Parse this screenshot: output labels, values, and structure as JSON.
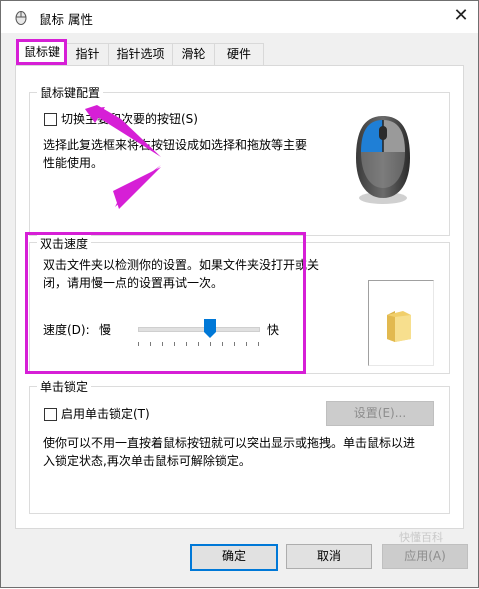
{
  "window": {
    "title": "鼠标 属性",
    "close_label": "✕"
  },
  "tabs": [
    {
      "label": "鼠标键",
      "active": true
    },
    {
      "label": "指针",
      "active": false
    },
    {
      "label": "指针选项",
      "active": false
    },
    {
      "label": "滑轮",
      "active": false
    },
    {
      "label": "硬件",
      "active": false
    }
  ],
  "button_config": {
    "group_title": "鼠标键配置",
    "switch_checkbox_label": "切换主要和次要的按钮(S)",
    "switch_checked": false,
    "description": "选择此复选框来将右按钮设成如选择和拖放等主要性能使用。",
    "description_line1": "选择此复选框来将右按钮设成如选择和拖放等主要",
    "description_line2": "性能使用。",
    "mouse_icon": "mouse-icon"
  },
  "double_click": {
    "group_title": "双击速度",
    "description_line1": "双击文件夹以检测你的设置。如果文件夹没打开或关",
    "description_line2": "闭，请用慢一点的设置再试一次。",
    "speed_label": "速度(D):",
    "slow_label": "慢",
    "fast_label": "快",
    "speed_value_fraction": 0.6,
    "folder_icon": "folder-icon"
  },
  "click_lock": {
    "group_title": "单击锁定",
    "checkbox_label": "启用单击锁定(T)",
    "checked": false,
    "settings_button": "设置(E)...",
    "description_line1": "使你可以不用一直按着鼠标按钮就可以突出显示或拖拽。单击鼠标以进",
    "description_line2": "入锁定状态,再次单击鼠标可解除锁定。"
  },
  "footer": {
    "ok_label": "确定",
    "cancel_label": "取消",
    "apply_label": "应用(A)"
  },
  "watermark": "快懂百科",
  "colors": {
    "highlight": "#d61fd6",
    "accent": "#0078d7",
    "mouse_blue": "#1f7fd6"
  }
}
